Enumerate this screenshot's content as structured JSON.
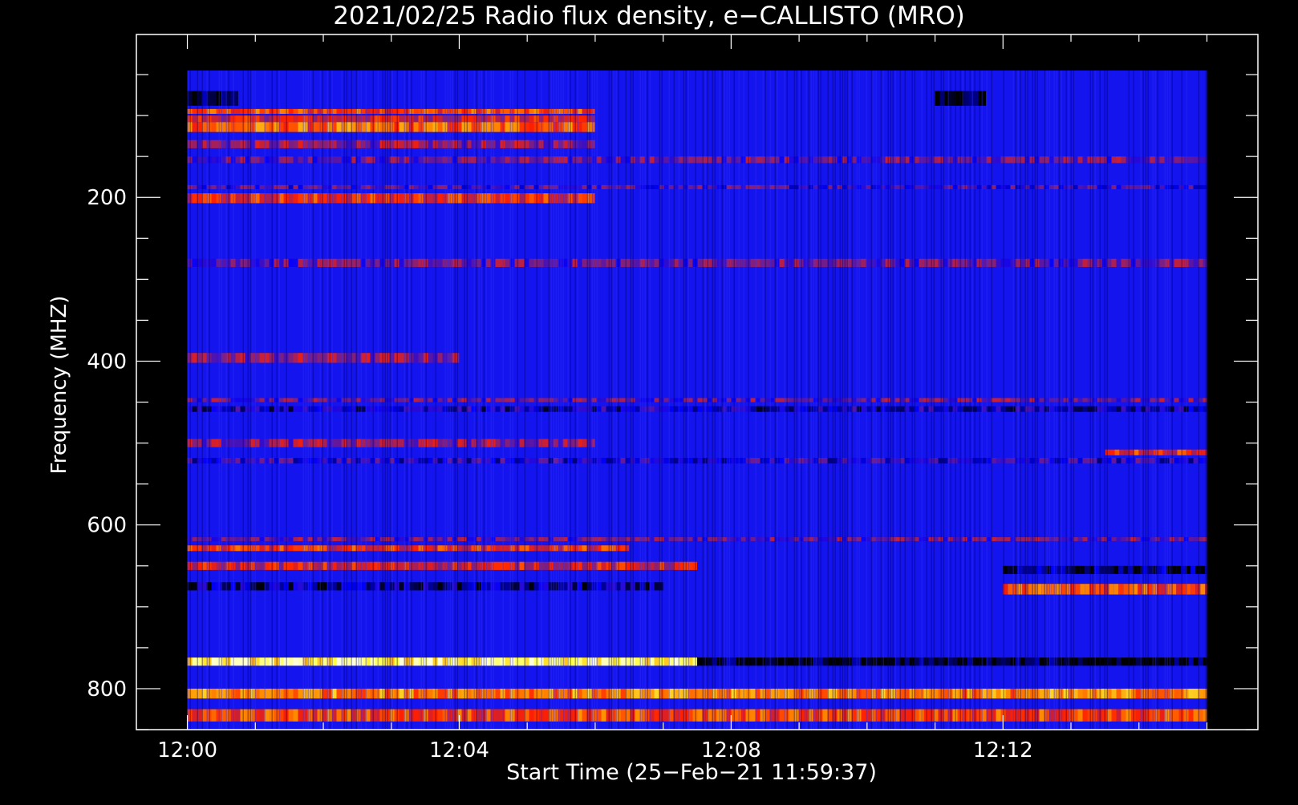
{
  "chart_data": {
    "type": "heatmap",
    "title": "2021/02/25  Radio flux density, e−CALLISTO (MRO)",
    "xlabel": "Start Time (25−Feb−21 11:59:37)",
    "ylabel": "Frequency (MHZ)",
    "x_ticks": [
      "12:00",
      "12:04",
      "12:08",
      "12:12"
    ],
    "x_tick_minutes": [
      0,
      4,
      8,
      12
    ],
    "y_ticks": [
      200,
      400,
      600,
      800
    ],
    "xlim_minutes": [
      -0.75,
      15.75
    ],
    "data_x_minutes": [
      0,
      15
    ],
    "ylim": [
      1,
      850
    ],
    "data_y": [
      45,
      850
    ],
    "y_reversed": true,
    "colormap": [
      "#000000",
      "#0000ff",
      "#7f1f7f",
      "#ff2000",
      "#ff9000",
      "#ffff40",
      "#ffffff"
    ],
    "background_color": "#1414ee",
    "bands": [
      {
        "y": [
          70,
          88
        ],
        "x": [
          0,
          0.75
        ],
        "level": 0.0
      },
      {
        "y": [
          70,
          88
        ],
        "x": [
          11,
          11.75
        ],
        "level": 0.0
      },
      {
        "y": [
          92,
          98
        ],
        "x": [
          0,
          6
        ],
        "level": 0.55
      },
      {
        "y": [
          100,
          108
        ],
        "x": [
          0,
          6
        ],
        "level": 0.45
      },
      {
        "y": [
          108,
          120
        ],
        "x": [
          0,
          6
        ],
        "level": 0.6
      },
      {
        "y": [
          130,
          140
        ],
        "x": [
          0,
          6
        ],
        "level": 0.35
      },
      {
        "y": [
          150,
          158
        ],
        "x": [
          0,
          15
        ],
        "level": 0.3
      },
      {
        "y": [
          185,
          190
        ],
        "x": [
          0,
          15
        ],
        "level": 0.25
      },
      {
        "y": [
          195,
          207
        ],
        "x": [
          0,
          6
        ],
        "level": 0.5
      },
      {
        "y": [
          275,
          285
        ],
        "x": [
          0,
          15
        ],
        "level": 0.3
      },
      {
        "y": [
          390,
          402
        ],
        "x": [
          0,
          4
        ],
        "level": 0.35
      },
      {
        "y": [
          445,
          450
        ],
        "x": [
          0,
          15
        ],
        "level": 0.3
      },
      {
        "y": [
          455,
          462
        ],
        "x": [
          0,
          15
        ],
        "level": 0.15
      },
      {
        "y": [
          495,
          505
        ],
        "x": [
          0,
          6
        ],
        "level": 0.35
      },
      {
        "y": [
          508,
          515
        ],
        "x": [
          13.5,
          15
        ],
        "level": 0.5
      },
      {
        "y": [
          518,
          525
        ],
        "x": [
          0,
          15
        ],
        "level": 0.2
      },
      {
        "y": [
          615,
          620
        ],
        "x": [
          0,
          15
        ],
        "level": 0.3
      },
      {
        "y": [
          625,
          632
        ],
        "x": [
          0,
          6.5
        ],
        "level": 0.5
      },
      {
        "y": [
          645,
          655
        ],
        "x": [
          0,
          7.5
        ],
        "level": 0.45
      },
      {
        "y": [
          650,
          660
        ],
        "x": [
          12,
          15
        ],
        "level": 0.05
      },
      {
        "y": [
          670,
          680
        ],
        "x": [
          0,
          7
        ],
        "level": 0.1
      },
      {
        "y": [
          672,
          685
        ],
        "x": [
          12,
          15
        ],
        "level": 0.55
      },
      {
        "y": [
          762,
          772
        ],
        "x": [
          0,
          15
        ],
        "level": 0.0
      },
      {
        "y": [
          762,
          772
        ],
        "x": [
          0,
          7.5
        ],
        "level": 0.85
      },
      {
        "y": [
          800,
          812
        ],
        "x": [
          0,
          15
        ],
        "level": 0.65
      },
      {
        "y": [
          825,
          840
        ],
        "x": [
          0,
          15
        ],
        "level": 0.55
      }
    ]
  }
}
